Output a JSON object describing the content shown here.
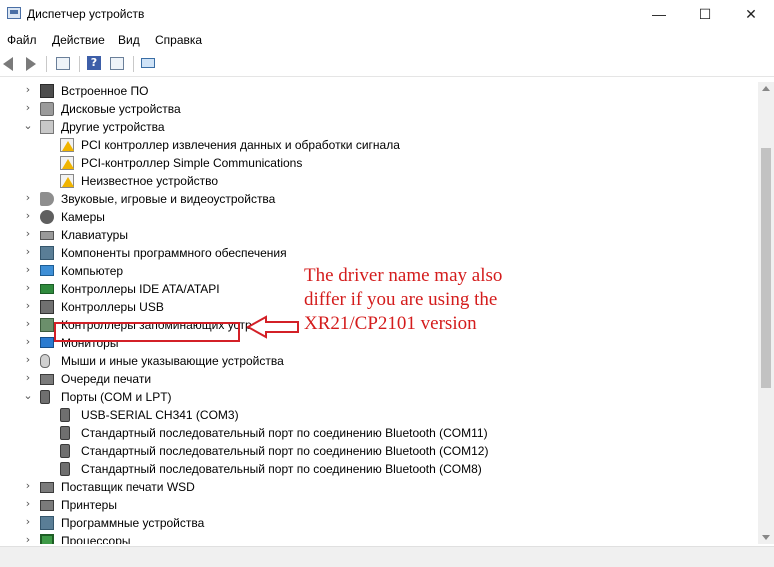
{
  "window": {
    "title": "Диспетчер устройств",
    "minimize": "—",
    "maximize": "☐",
    "close": "✕"
  },
  "menu": [
    "Файл",
    "Действие",
    "Вид",
    "Справка"
  ],
  "toolbar": {
    "icons": [
      "back-icon",
      "forward-icon",
      "properties-icon",
      "help-icon",
      "view-icon",
      "scan-hardware-icon"
    ],
    "help_glyph": "?"
  },
  "tree": [
    {
      "label": "Встроенное ПО",
      "expander": "›",
      "icon": "firmware-icon"
    },
    {
      "label": "Дисковые устройства",
      "expander": "›",
      "icon": "disk-icon"
    },
    {
      "label": "Другие устройства",
      "expander": "⌄",
      "icon": "other-devices-icon"
    },
    {
      "label": "PCI контроллер извлечения данных и обработки сигнала",
      "expander": "",
      "icon": "warning-icon"
    },
    {
      "label": "PCI-контроллер Simple Communications",
      "expander": "",
      "icon": "warning-icon"
    },
    {
      "label": "Неизвестное устройство",
      "expander": "",
      "icon": "warning-icon"
    },
    {
      "label": "Звуковые, игровые и видеоустройства",
      "expander": "›",
      "icon": "speaker-icon"
    },
    {
      "label": "Камеры",
      "expander": "›",
      "icon": "camera-icon"
    },
    {
      "label": "Клавиатуры",
      "expander": "›",
      "icon": "keyboard-icon"
    },
    {
      "label": "Компоненты программного обеспечения",
      "expander": "›",
      "icon": "software-component-icon"
    },
    {
      "label": "Компьютер",
      "expander": "›",
      "icon": "computer-icon"
    },
    {
      "label": "Контроллеры IDE ATA/ATAPI",
      "expander": "›",
      "icon": "ide-controller-icon"
    },
    {
      "label": "Контроллеры USB",
      "expander": "›",
      "icon": "usb-controller-icon"
    },
    {
      "label": "Контроллеры запоминающих устройств",
      "expander": "›",
      "icon": "storage-controller-icon"
    },
    {
      "label": "Мониторы",
      "expander": "›",
      "icon": "monitor-icon"
    },
    {
      "label": "Мыши и иные указывающие устройства",
      "expander": "›",
      "icon": "mouse-icon"
    },
    {
      "label": "Очереди печати",
      "expander": "›",
      "icon": "print-queue-icon"
    },
    {
      "label": "Порты (COM и LPT)",
      "expander": "⌄",
      "icon": "port-icon"
    },
    {
      "label": "USB-SERIAL CH341 (COM3)",
      "expander": "",
      "icon": "serial-port-icon"
    },
    {
      "label": "Стандартный последовательный порт по соединению Bluetooth (COM11)",
      "expander": "",
      "icon": "serial-port-icon"
    },
    {
      "label": "Стандартный последовательный порт по соединению Bluetooth (COM12)",
      "expander": "",
      "icon": "serial-port-icon"
    },
    {
      "label": "Стандартный последовательный порт по соединению Bluetooth (COM8)",
      "expander": "",
      "icon": "serial-port-icon"
    },
    {
      "label": "Поставщик печати WSD",
      "expander": "›",
      "icon": "printer-icon"
    },
    {
      "label": "Принтеры",
      "expander": "›",
      "icon": "printer-icon"
    },
    {
      "label": "Программные устройства",
      "expander": "›",
      "icon": "software-device-icon"
    },
    {
      "label": "Процессоры",
      "expander": "›",
      "icon": "processor-icon"
    }
  ],
  "annotation": {
    "text": "The driver name may also\ndiffer if you are using the\nXR21/CP2101 version",
    "color": "#d41c1c"
  }
}
